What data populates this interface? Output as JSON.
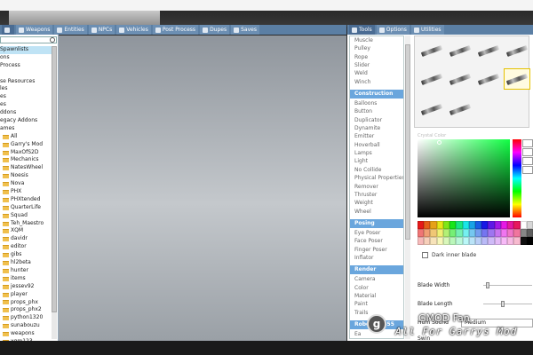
{
  "spawnmenu": {
    "tabs": [
      {
        "label": "",
        "icon": "spawnlist-icon"
      },
      {
        "label": "Weapons",
        "icon": "weapons-icon"
      },
      {
        "label": "Entities",
        "icon": "entities-icon"
      },
      {
        "label": "NPCs",
        "icon": "npc-icon"
      },
      {
        "label": "Vehicles",
        "icon": "vehicle-icon"
      },
      {
        "label": "Post Process",
        "icon": "postprocess-icon"
      },
      {
        "label": "Dupes",
        "icon": "dupes-icon"
      },
      {
        "label": "Saves",
        "icon": "saves-icon"
      }
    ],
    "tree": [
      {
        "label": "Spawnlists",
        "selected": true,
        "folder": false
      },
      {
        "label": "ons",
        "folder": false
      },
      {
        "label": "Process",
        "folder": false
      },
      {
        "label": "",
        "folder": false
      },
      {
        "label": "se Resources",
        "folder": false
      },
      {
        "label": "les",
        "folder": false
      },
      {
        "label": "es",
        "folder": false
      },
      {
        "label": "es",
        "folder": false
      },
      {
        "label": "ddons",
        "folder": false
      },
      {
        "label": "egacy Addons",
        "folder": false
      },
      {
        "label": "ames",
        "folder": false
      },
      {
        "label": "All",
        "folder": true
      },
      {
        "label": "Garry's Mod",
        "folder": true
      },
      {
        "label": "MaxOfS2D",
        "folder": true
      },
      {
        "label": "Mechanics",
        "folder": true
      },
      {
        "label": "NatesWheel",
        "folder": true
      },
      {
        "label": "Noesis",
        "folder": true
      },
      {
        "label": "Nova",
        "folder": true
      },
      {
        "label": "PHX",
        "folder": true
      },
      {
        "label": "PHXtended",
        "folder": true
      },
      {
        "label": "QuarterLife",
        "folder": true
      },
      {
        "label": "Squad",
        "folder": true
      },
      {
        "label": "Teh_Maestro",
        "folder": true
      },
      {
        "label": "XQM",
        "folder": true
      },
      {
        "label": "davidr",
        "folder": true
      },
      {
        "label": "editor",
        "folder": true
      },
      {
        "label": "gibs",
        "folder": true
      },
      {
        "label": "hl2beta",
        "folder": true
      },
      {
        "label": "hunter",
        "folder": true
      },
      {
        "label": "items",
        "folder": true
      },
      {
        "label": "jessev92",
        "folder": true
      },
      {
        "label": "player",
        "folder": true
      },
      {
        "label": "props_phx",
        "folder": true
      },
      {
        "label": "props_phx2",
        "folder": true
      },
      {
        "label": "python1320",
        "folder": true
      },
      {
        "label": "sunabouzu",
        "folder": true
      },
      {
        "label": "weapons",
        "folder": true
      },
      {
        "label": "xqm123",
        "folder": true
      }
    ]
  },
  "context": {
    "tabs": [
      {
        "label": "Tools",
        "icon": "tools-icon"
      },
      {
        "label": "Options",
        "icon": "options-icon"
      },
      {
        "label": "Utilities",
        "icon": "utilities-icon"
      }
    ],
    "toollist": [
      {
        "type": "item",
        "label": "Muscle"
      },
      {
        "type": "item",
        "label": "Pulley"
      },
      {
        "type": "item",
        "label": "Rope"
      },
      {
        "type": "item",
        "label": "Slider"
      },
      {
        "type": "item",
        "label": "Weld"
      },
      {
        "type": "item",
        "label": "Winch"
      },
      {
        "type": "gap"
      },
      {
        "type": "head",
        "label": "Construction"
      },
      {
        "type": "item",
        "label": "Balloons"
      },
      {
        "type": "item",
        "label": "Button"
      },
      {
        "type": "item",
        "label": "Duplicator"
      },
      {
        "type": "item",
        "label": "Dynamite"
      },
      {
        "type": "item",
        "label": "Emitter"
      },
      {
        "type": "item",
        "label": "Hoverball"
      },
      {
        "type": "item",
        "label": "Lamps"
      },
      {
        "type": "item",
        "label": "Light"
      },
      {
        "type": "item",
        "label": "No Collide"
      },
      {
        "type": "item",
        "label": "Physical Properties"
      },
      {
        "type": "item",
        "label": "Remover"
      },
      {
        "type": "item",
        "label": "Thruster"
      },
      {
        "type": "item",
        "label": "Weight"
      },
      {
        "type": "item",
        "label": "Wheel"
      },
      {
        "type": "gap"
      },
      {
        "type": "head",
        "label": "Posing"
      },
      {
        "type": "item",
        "label": "Eye Poser"
      },
      {
        "type": "item",
        "label": "Face Poser"
      },
      {
        "type": "item",
        "label": "Finger Poser"
      },
      {
        "type": "item",
        "label": "Inflator"
      },
      {
        "type": "gap"
      },
      {
        "type": "head",
        "label": "Render"
      },
      {
        "type": "item",
        "label": "Camera"
      },
      {
        "type": "item",
        "label": "Color"
      },
      {
        "type": "item",
        "label": "Material"
      },
      {
        "type": "item",
        "label": "Paint"
      },
      {
        "type": "item",
        "label": "Trails"
      },
      {
        "type": "gap"
      },
      {
        "type": "head",
        "label": "Robotboy655"
      },
      {
        "type": "item",
        "label": "Ea"
      },
      {
        "type": "item",
        "label": "Ex"
      },
      {
        "type": "item",
        "label": "",
        "selected": true
      }
    ],
    "props": {
      "color_label": "Crystal Color",
      "dark_inner_label": "Dark inner blade",
      "blade_width_label": "Blade Width",
      "blade_length_label": "Blade Length",
      "hum_sound_label": "Hum Sound",
      "hum_sound_value": "Medium",
      "swing_label": "Swin",
      "blade_width_value": 0.06,
      "blade_length_value": 0.4
    }
  },
  "overlay": {
    "icon": "gmod-logo-icon",
    "line1": "GMOD Fan",
    "line2": "All For Garrys Mod"
  },
  "colors": {
    "tab_bar": "#5b7fa4",
    "category_header": "#6aa6dd",
    "selected_tool": "#3c7fd0"
  }
}
